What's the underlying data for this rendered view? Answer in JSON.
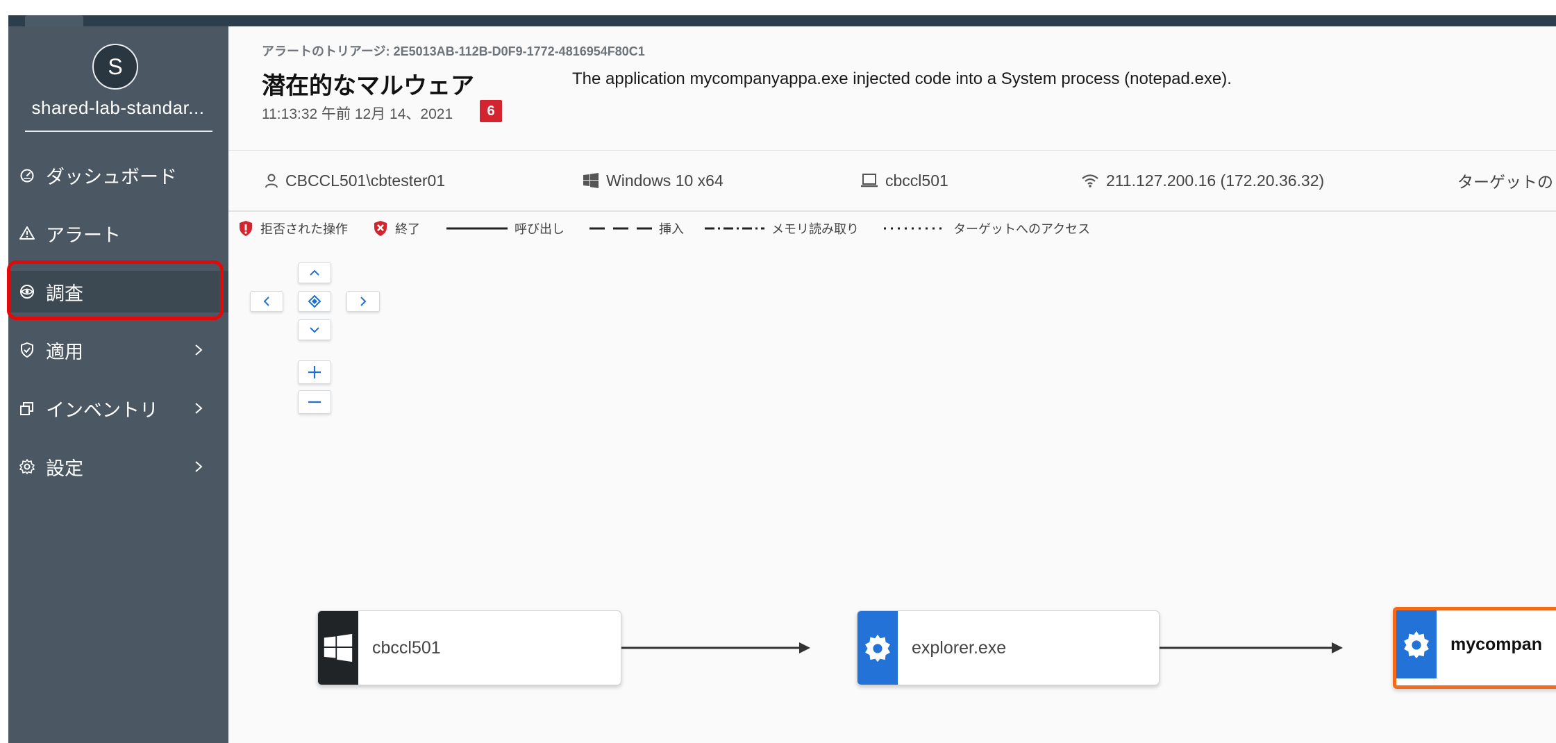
{
  "sidebar": {
    "avatar_initial": "S",
    "org_name": "shared-lab-standar...",
    "items": [
      {
        "label": "ダッシュボード",
        "icon": "dashboard-gauge-icon"
      },
      {
        "label": "アラート",
        "icon": "warning-triangle-icon"
      },
      {
        "label": "調査",
        "icon": "investigate-eye-icon",
        "active": true
      },
      {
        "label": "適用",
        "icon": "shield-check-icon",
        "has_children": true
      },
      {
        "label": "インベントリ",
        "icon": "inventory-windows-icon",
        "has_children": true
      },
      {
        "label": "設定",
        "icon": "gear-icon",
        "has_children": true
      }
    ]
  },
  "header": {
    "triage_id": "アラートのトリアージ: 2E5013AB-112B-D0F9-1772-4816954F80C1",
    "title": "潜在的なマルウェア",
    "description": "The application mycompanyappa.exe injected code into a System process (notepad.exe).",
    "timestamp": "11:13:32 午前 12月 14、2021",
    "score": "6"
  },
  "info_bar": {
    "user": "CBCCL501\\cbtester01",
    "os": "Windows 10 x64",
    "device": "cbccl501",
    "ip": "211.127.200.16 (172.20.36.32)",
    "target_truncated": "ターゲットの"
  },
  "legend": {
    "denied": "拒否された操作",
    "terminated": "終了",
    "invoke": "呼び出し",
    "inject": "挿入",
    "memory_read": "メモリ読み取り",
    "target_access": "ターゲットへのアクセス"
  },
  "graph": {
    "nodes": [
      {
        "label": "cbccl501",
        "icon": "windows-logo-icon"
      },
      {
        "label": "explorer.exe",
        "icon": "gear-icon"
      },
      {
        "label": "mycompan",
        "icon": "gear-icon",
        "selected": true
      }
    ]
  },
  "colors": {
    "sidebar_bg": "#4b5863",
    "accent_blue": "#2272d8",
    "danger_red": "#d3252f",
    "selected_orange": "#f26a1b",
    "highlight_red": "#e00a0a"
  }
}
